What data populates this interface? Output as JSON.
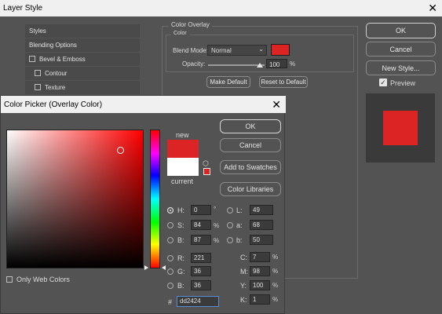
{
  "layer_style": {
    "title": "Layer Style",
    "sidebar": [
      "Styles",
      "Blending Options",
      "Bevel & Emboss",
      "Contour",
      "Texture"
    ],
    "overlay_group": "Color Overlay",
    "color_group": "Color",
    "blend_mode_label": "Blend Mode:",
    "blend_mode_value": "Normal",
    "opacity_label": "Opacity:",
    "opacity_value": "100",
    "opacity_unit": "%",
    "make_default": "Make Default",
    "reset_default": "Reset to Default",
    "ok": "OK",
    "cancel": "Cancel",
    "new_style": "New Style...",
    "preview_label": "Preview",
    "swatch_color": "#dd2424"
  },
  "color_picker": {
    "title": "Color Picker (Overlay Color)",
    "new_label": "new",
    "current_label": "current",
    "ok": "OK",
    "cancel": "Cancel",
    "add_swatches": "Add to Swatches",
    "color_libraries": "Color Libraries",
    "only_web": "Only Web Colors",
    "hsb": [
      {
        "label": "H:",
        "value": "0",
        "unit": "°"
      },
      {
        "label": "S:",
        "value": "84",
        "unit": "%"
      },
      {
        "label": "B:",
        "value": "87",
        "unit": "%"
      }
    ],
    "rgb": [
      {
        "label": "R:",
        "value": "221"
      },
      {
        "label": "G:",
        "value": "36"
      },
      {
        "label": "B:",
        "value": "36"
      }
    ],
    "lab": [
      {
        "label": "L:",
        "value": "49"
      },
      {
        "label": "a:",
        "value": "68"
      },
      {
        "label": "b:",
        "value": "50"
      }
    ],
    "cmyk": [
      {
        "label": "C:",
        "value": "7",
        "unit": "%"
      },
      {
        "label": "M:",
        "value": "98",
        "unit": "%"
      },
      {
        "label": "Y:",
        "value": "100",
        "unit": "%"
      },
      {
        "label": "K:",
        "value": "1",
        "unit": "%"
      }
    ],
    "hex_label": "#",
    "hex_value": "dd2424",
    "new_color": "#dd2424",
    "current_color": "#ffffff"
  }
}
